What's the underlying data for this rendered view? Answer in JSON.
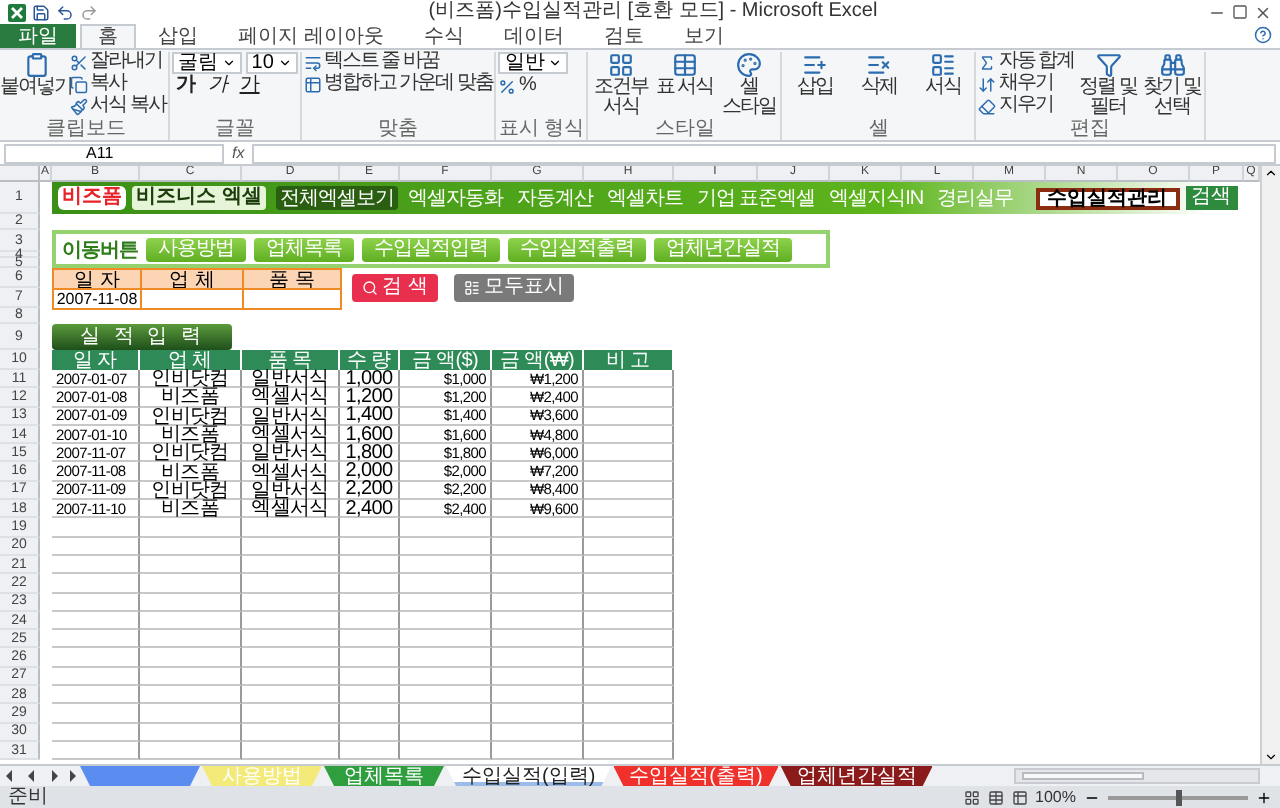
{
  "window": {
    "title": "(비즈폼)수입실적관리 [호환 모드] - Microsoft Excel"
  },
  "ribbon_tabs": [
    {
      "label": "파일",
      "kind": "file",
      "selected": false
    },
    {
      "label": "홈",
      "kind": "tab",
      "selected": true
    },
    {
      "label": "삽입",
      "kind": "tab",
      "selected": false
    },
    {
      "label": "페이지 레이아웃",
      "kind": "tab",
      "selected": false
    },
    {
      "label": "수식",
      "kind": "tab",
      "selected": false
    },
    {
      "label": "데이터",
      "kind": "tab",
      "selected": false
    },
    {
      "label": "검토",
      "kind": "tab",
      "selected": false
    },
    {
      "label": "보기",
      "kind": "tab",
      "selected": false
    }
  ],
  "ribbon_groups": [
    {
      "label": "클립보드",
      "columns": [
        [
          {
            "kind": "large",
            "label": "붙여넣기"
          }
        ],
        [
          {
            "kind": "small",
            "label": "잘라내기"
          },
          {
            "kind": "small",
            "label": "복사"
          },
          {
            "kind": "small",
            "label": "서식 복사"
          }
        ]
      ]
    },
    {
      "label": "글꼴",
      "columns": [
        [
          {
            "kind": "row",
            "items": [
              {
                "kind": "field",
                "value": "굴림"
              },
              {
                "kind": "field",
                "value": "10"
              }
            ]
          },
          {
            "kind": "row",
            "items": [
              {
                "kind": "bold",
                "label": "가"
              },
              {
                "kind": "italic",
                "label": "가"
              },
              {
                "kind": "underline",
                "label": "가"
              }
            ]
          }
        ]
      ]
    },
    {
      "label": "맞춤",
      "columns": [
        [
          {
            "kind": "small",
            "label": "텍스트 줄 바꿈"
          },
          {
            "kind": "small",
            "label": "병합하고 가운데 맞춤"
          }
        ]
      ]
    },
    {
      "label": "표시 형식",
      "columns": [
        [
          {
            "kind": "field",
            "value": "일반"
          },
          {
            "kind": "small",
            "label": "%"
          }
        ]
      ]
    },
    {
      "label": "스타일",
      "columns": [
        [
          {
            "kind": "large",
            "label": "조건부 서식"
          }
        ],
        [
          {
            "kind": "large",
            "label": "표 서식"
          }
        ],
        [
          {
            "kind": "large",
            "label": "셀 스타일"
          }
        ]
      ]
    },
    {
      "label": "셀",
      "columns": [
        [
          {
            "kind": "large",
            "label": "삽입"
          }
        ],
        [
          {
            "kind": "large",
            "label": "삭제"
          }
        ],
        [
          {
            "kind": "large",
            "label": "서식"
          }
        ]
      ]
    },
    {
      "label": "편집",
      "columns": [
        [
          {
            "kind": "small",
            "label": "자동 합계"
          },
          {
            "kind": "small",
            "label": "채우기"
          },
          {
            "kind": "small",
            "label": "지우기"
          }
        ],
        [
          {
            "kind": "large",
            "label": "정렬 및 필터"
          }
        ],
        [
          {
            "kind": "large",
            "label": "찾기 및 선택"
          }
        ]
      ]
    }
  ],
  "formula_bar": {
    "name_box": "A11",
    "fx": "fx"
  },
  "columns": [
    "A",
    "B",
    "C",
    "D",
    "E",
    "F",
    "G",
    "H",
    "I",
    "J",
    "K",
    "L",
    "M",
    "N",
    "O",
    "P",
    "Q"
  ],
  "row_numbers": [
    "1",
    "2",
    "3",
    "4",
    "5",
    "6",
    "7",
    "8",
    "9",
    "10",
    "11",
    "12",
    "13",
    "14",
    "15",
    "16",
    "17",
    "18",
    "19",
    "20",
    "21",
    "22",
    "23",
    "24",
    "25",
    "26",
    "27",
    "28",
    "29",
    "30",
    "31"
  ],
  "banner": {
    "logo": "비즈폼",
    "logo_2": "비즈니스 엑셀",
    "menu": [
      {
        "label": "전체엑셀보기",
        "selected": true
      },
      {
        "label": "엑셀자동화",
        "selected": false
      },
      {
        "label": "자동계산",
        "selected": false
      },
      {
        "label": "엑셀차트",
        "selected": false
      },
      {
        "label": "기업 표준엑셀",
        "selected": false
      },
      {
        "label": "엑셀지식IN",
        "selected": false
      },
      {
        "label": "경리실무",
        "selected": false
      }
    ],
    "search_value": "수입실적관리",
    "search_button": "검색"
  },
  "nav": {
    "label": "이동버튼",
    "buttons": [
      "사용방법",
      "업체목록",
      "수입실적입력",
      "수입실적출력",
      "업체년간실적"
    ]
  },
  "filter": {
    "headers": [
      "일 자",
      "업 체",
      "품 목"
    ],
    "values": [
      "2007-11-08"
    ],
    "search_button": "검 색",
    "show_all_button": "모두표시"
  },
  "section_title": "실 적 입 력",
  "table": {
    "columns": [
      "일 자",
      "업 체",
      "품 목",
      "수 량",
      "금 액($)",
      "금 액(₩)",
      "비 고"
    ],
    "rows": [
      [
        "2007-01-07",
        "인비닷컴",
        "일반서식",
        "1,000",
        "$1,000",
        "₩1,200",
        ""
      ],
      [
        "2007-01-08",
        "비즈폼",
        "엑셀서식",
        "1,200",
        "$1,200",
        "₩2,400",
        ""
      ],
      [
        "2007-01-09",
        "인비닷컴",
        "일반서식",
        "1,400",
        "$1,400",
        "₩3,600",
        ""
      ],
      [
        "2007-01-10",
        "비즈폼",
        "엑셀서식",
        "1,600",
        "$1,600",
        "₩4,800",
        ""
      ],
      [
        "2007-11-07",
        "인비닷컴",
        "일반서식",
        "1,800",
        "$1,800",
        "₩6,000",
        ""
      ],
      [
        "2007-11-08",
        "비즈폼",
        "엑셀서식",
        "2,000",
        "$2,000",
        "₩7,200",
        ""
      ],
      [
        "2007-11-09",
        "인비닷컴",
        "일반서식",
        "2,200",
        "$2,200",
        "₩8,400",
        ""
      ],
      [
        "2007-11-10",
        "비즈폼",
        "엑셀서식",
        "2,400",
        "$2,400",
        "₩9,600",
        ""
      ]
    ]
  },
  "sheet_tabs": [
    {
      "color": "#5b8cf0",
      "selected": false
    },
    {
      "label": "사용방법",
      "color": "#f3ea7a",
      "selected": false
    },
    {
      "label": "업체목록",
      "color": "#2e9e3e",
      "selected": false
    },
    {
      "label": "수입실적(입력)",
      "color": "#9bbbe8",
      "selected": true
    },
    {
      "label": "수입실적(출력)",
      "color": "#f0302a",
      "selected": false
    },
    {
      "label": "업체년간실적",
      "color": "#8b1a1a",
      "selected": false
    }
  ],
  "status_bar": {
    "text": "준비",
    "zoom": "100%",
    "level": 0.5
  }
}
